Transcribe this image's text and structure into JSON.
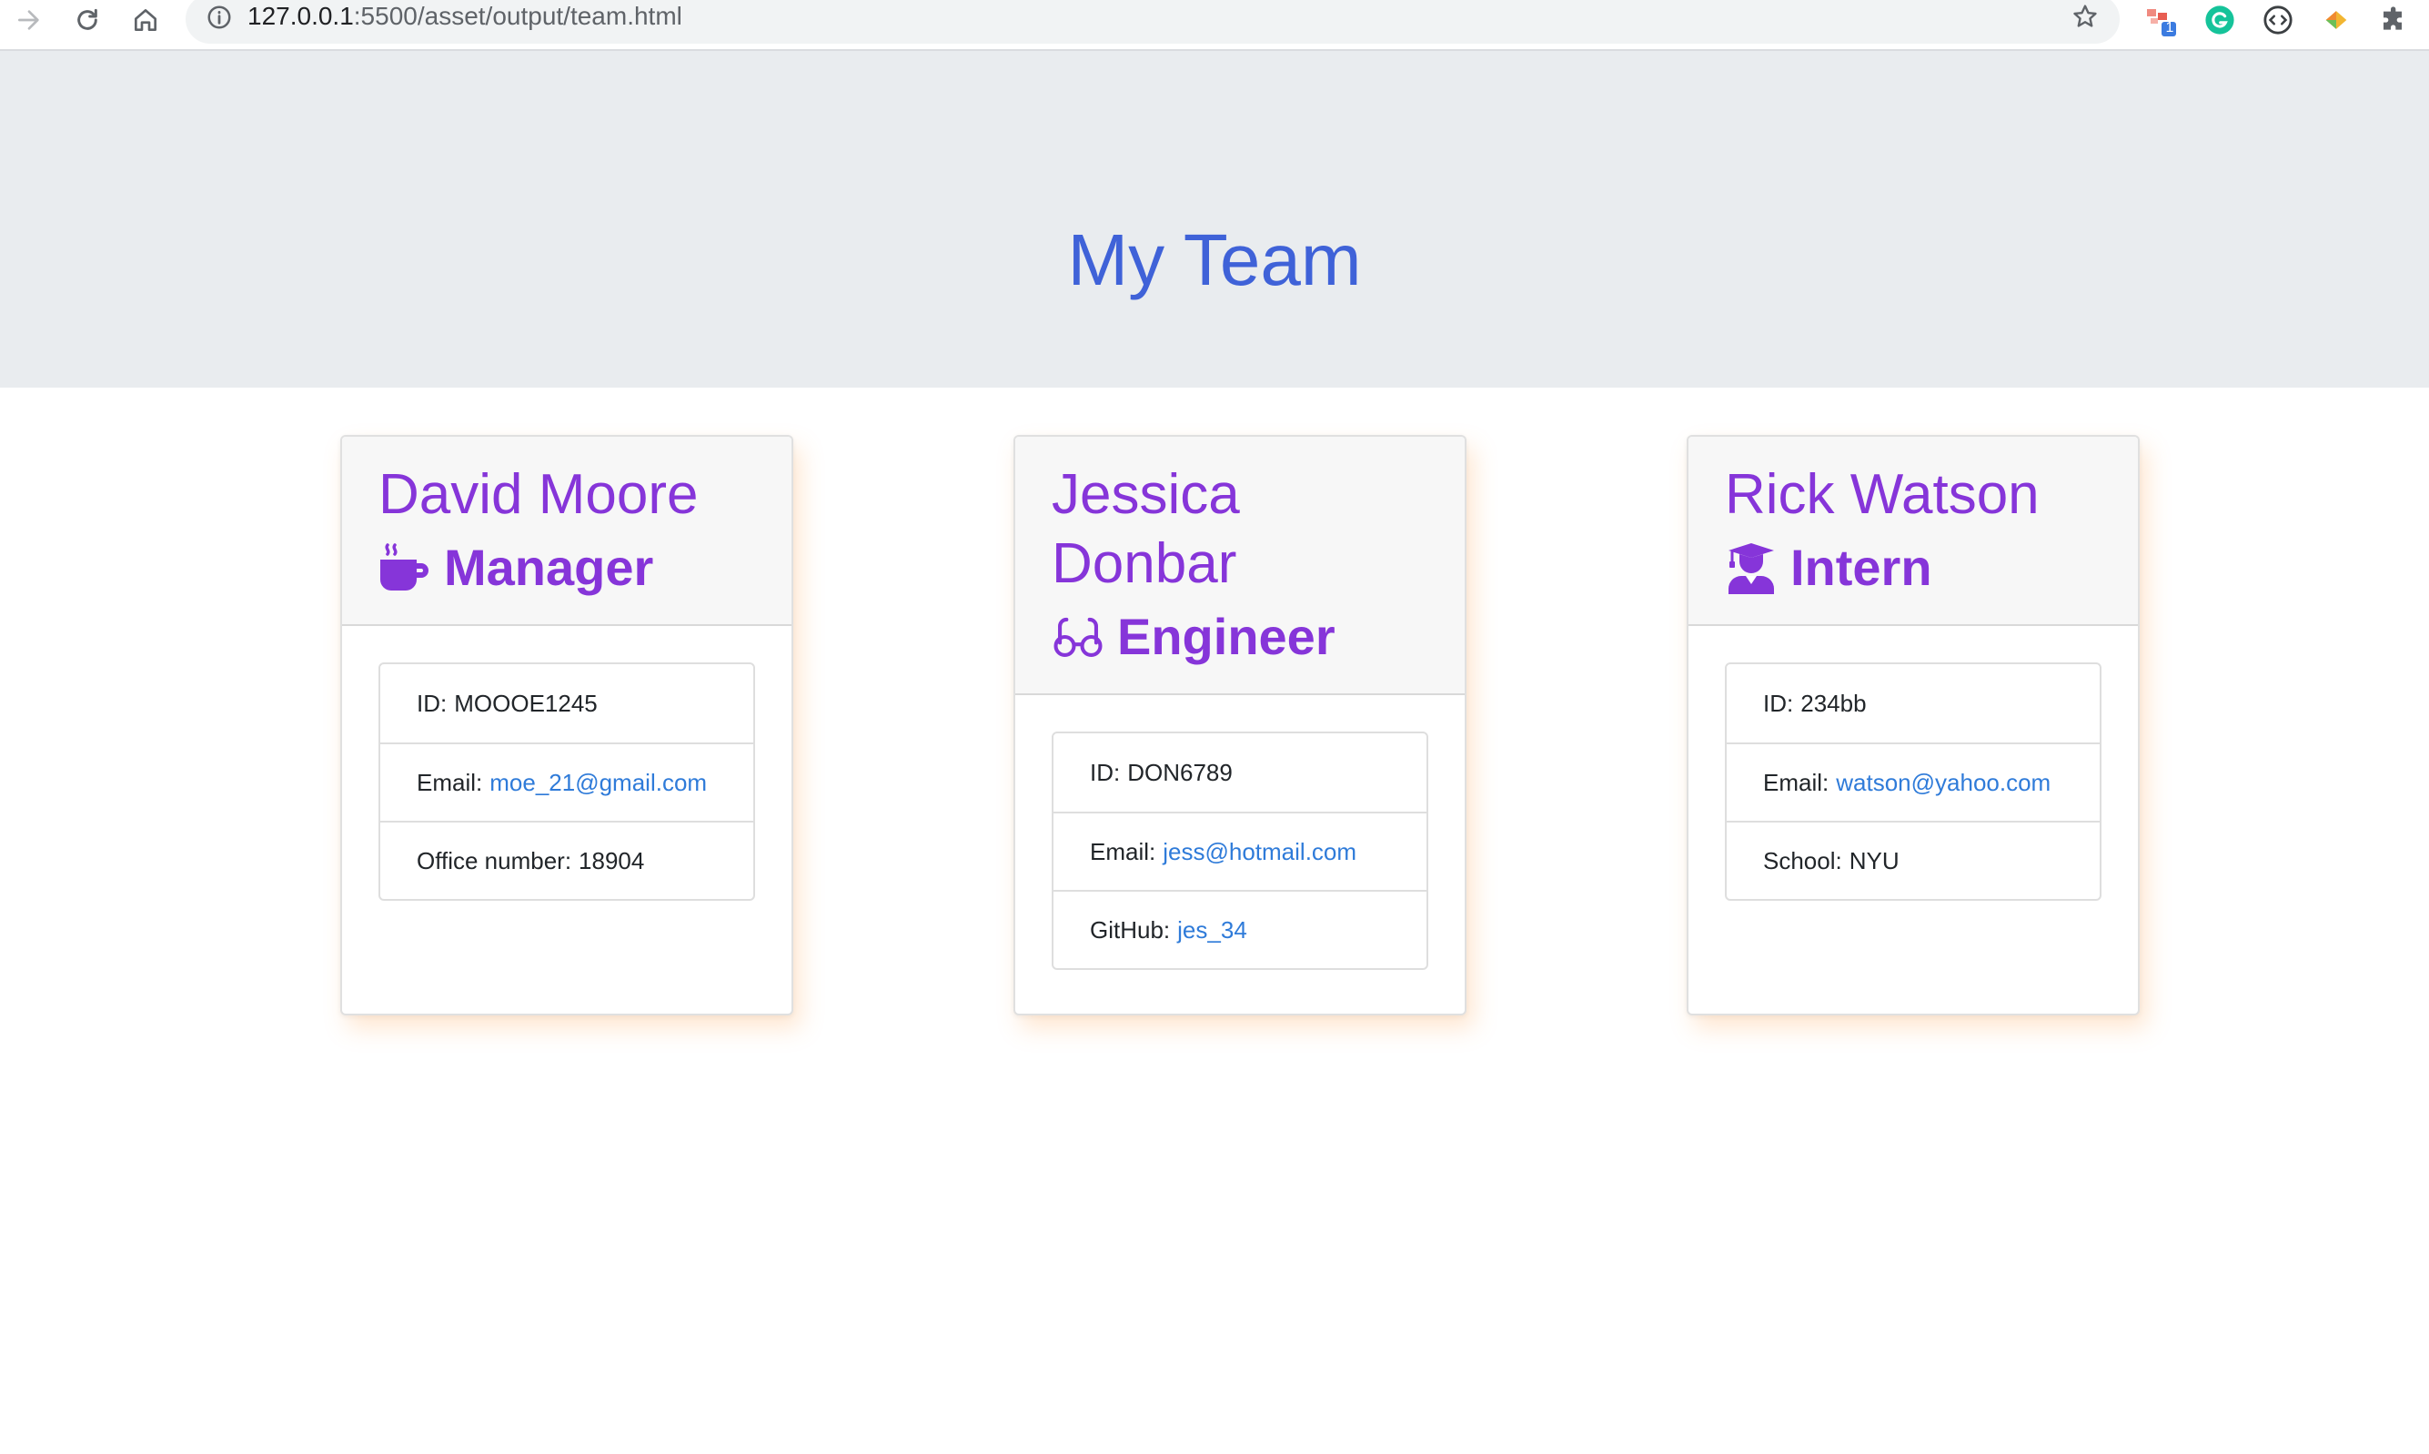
{
  "browser": {
    "url_host": "127.0.0.1",
    "url_rest": ":5500/asset/output/team.html",
    "extension_badge": "1"
  },
  "header": {
    "title": "My Team"
  },
  "employees": [
    {
      "name": "David Moore",
      "role": "Manager",
      "role_icon": "coffee-mug-icon",
      "id_label": "ID:",
      "id_value": "MOOOE1245",
      "email_label": "Email:",
      "email": "moe_21@gmail.com",
      "extra_label": "Office number:",
      "extra_value": "18904"
    },
    {
      "name": "Jessica Donbar",
      "role": "Engineer",
      "role_icon": "glasses-icon",
      "id_label": "ID:",
      "id_value": "DON6789",
      "email_label": "Email:",
      "email": "jess@hotmail.com",
      "extra_label": "GitHub:",
      "extra_value": "jes_34"
    },
    {
      "name": "Rick Watson",
      "role": "Intern",
      "role_icon": "graduate-icon",
      "id_label": "ID:",
      "id_value": "234bb",
      "email_label": "Email:",
      "email": "watson@yahoo.com",
      "extra_label": "School:",
      "extra_value": "NYU"
    }
  ],
  "colors": {
    "title": "#3f62d8",
    "accent": "#8635d9",
    "link": "#2f7bd9",
    "jumbotron": "#e9ecef"
  }
}
